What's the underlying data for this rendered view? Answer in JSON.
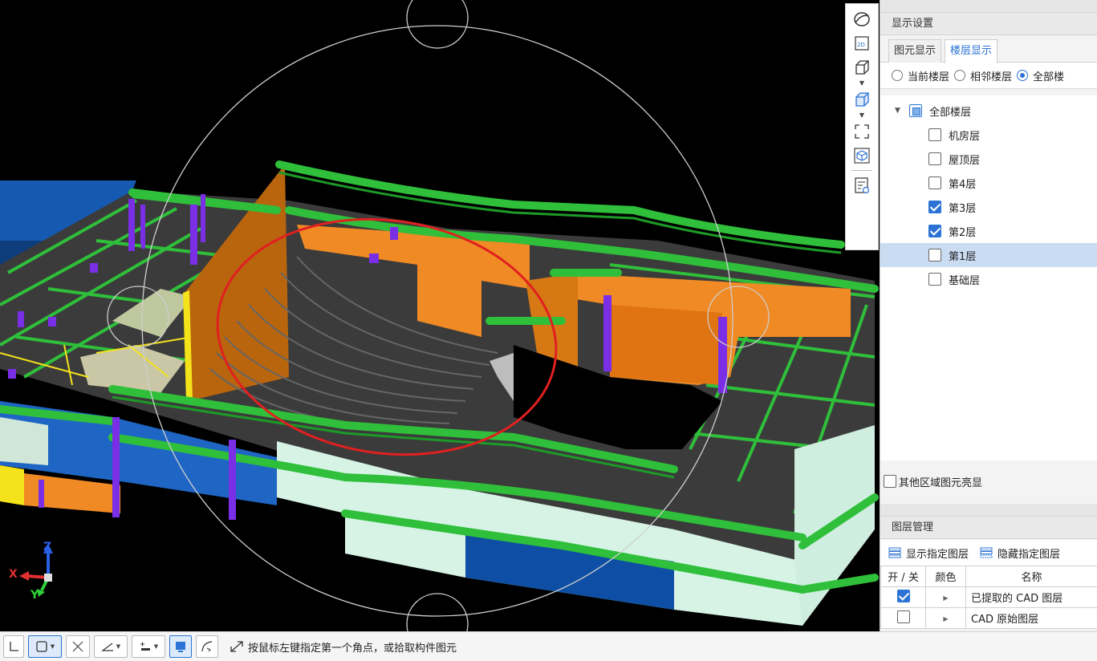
{
  "viewport": {
    "background": "#000000",
    "axis_labels": {
      "x": "X",
      "y": "Y",
      "z": "Z"
    },
    "annotation_color": "#e02020"
  },
  "view_toolbar": {
    "icons": [
      "orbit-icon",
      "2d-view-icon",
      "cube-view-icon",
      "cube-solid-view-icon",
      "fullscreen-icon",
      "3d-box-icon",
      "display-settings-icon"
    ]
  },
  "display_settings": {
    "title": "显示设置",
    "tabs": [
      {
        "label": "图元显示",
        "active": false
      },
      {
        "label": "楼层显示",
        "active": true
      }
    ],
    "radio_options": [
      {
        "label": "当前楼层",
        "selected": false
      },
      {
        "label": "相邻楼层",
        "selected": false
      },
      {
        "label": "全部楼",
        "selected": true
      }
    ],
    "floor_tree": {
      "root": {
        "label": "全部楼层",
        "state": "partial"
      },
      "floors": [
        {
          "label": "机房层",
          "checked": false,
          "selected": false
        },
        {
          "label": "屋顶层",
          "checked": false,
          "selected": false
        },
        {
          "label": "第4层",
          "checked": false,
          "selected": false
        },
        {
          "label": "第3层",
          "checked": true,
          "selected": false
        },
        {
          "label": "第2层",
          "checked": true,
          "selected": false
        },
        {
          "label": "第1层",
          "checked": false,
          "selected": true
        },
        {
          "label": "基础层",
          "checked": false,
          "selected": false
        }
      ]
    },
    "highlight_others": {
      "label": "其他区域图元亮显",
      "checked": false
    }
  },
  "layer_management": {
    "title": "图层管理",
    "show_button": "显示指定图层",
    "hide_button": "隐藏指定图层",
    "columns": [
      "开 / 关",
      "颜色",
      "名称"
    ],
    "rows": [
      {
        "on": true,
        "name": "已提取的 CAD 图层"
      },
      {
        "on": false,
        "name": "CAD 原始图层"
      }
    ]
  },
  "status_bar": {
    "message": "按鼠标左键指定第一个角点，或拾取构件图元"
  },
  "colors": {
    "accent": "#2b73d4",
    "beam_green": "#2fbf3a",
    "wall_orange": "#f08a24",
    "column_purple": "#7a2ee6",
    "slab_gray": "#3d3d3d",
    "glass_mint": "#d6f3e6",
    "blue_block": "#1357a8",
    "yellow": "#f4e21a"
  }
}
